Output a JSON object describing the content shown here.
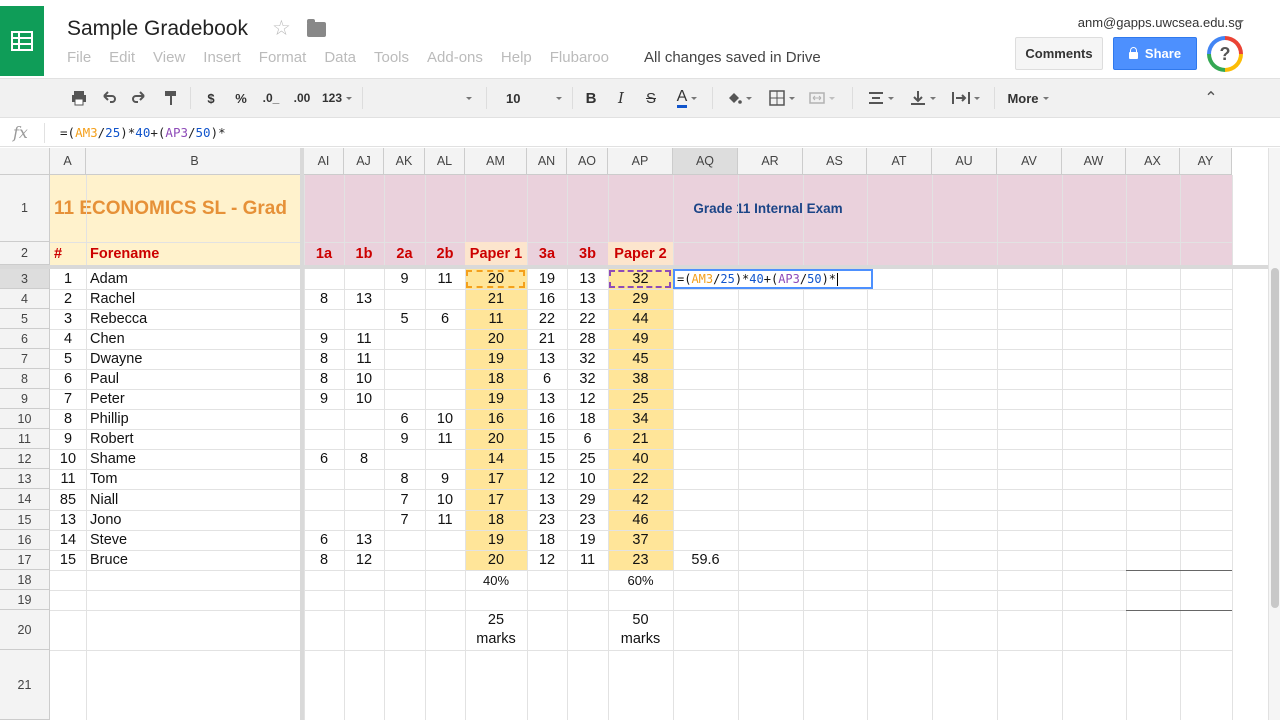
{
  "app": {
    "doc_title": "Sample Gradebook",
    "menus": [
      "File",
      "Edit",
      "View",
      "Insert",
      "Format",
      "Data",
      "Tools",
      "Add-ons",
      "Help",
      "Flubaroo"
    ],
    "save_status": "All changes saved in Drive",
    "account": "anm@gapps.uwcsea.edu.sg",
    "comments_label": "Comments",
    "share_label": "Share",
    "help_glyph": "?",
    "brand_color": "#0f9d58",
    "share_color": "#4d90fe"
  },
  "toolbar": {
    "currency": "$",
    "percent": "%",
    "dec_less": ".0_",
    "dec_more": ".00",
    "format_more": "123",
    "font_size": "10",
    "bold": "B",
    "italic": "I",
    "strike": "S",
    "text_color": "A",
    "more_label": "More"
  },
  "formula_bar": {
    "fx": "fx",
    "parts": [
      "=(",
      "AM3",
      "/",
      "25",
      ")*",
      "40",
      "+(",
      "AP3",
      "/",
      "50",
      ")*"
    ]
  },
  "sheet": {
    "columns": [
      "A",
      "B",
      "AI",
      "AJ",
      "AK",
      "AL",
      "AM",
      "AN",
      "AO",
      "AP",
      "AQ",
      "AR",
      "AS",
      "AT",
      "AU",
      "AV",
      "AW",
      "AX",
      "AY"
    ],
    "row_numbers": [
      "1",
      "2",
      "3",
      "4",
      "5",
      "6",
      "7",
      "8",
      "9",
      "10",
      "11",
      "12",
      "13",
      "14",
      "15",
      "16",
      "17",
      "18",
      "19",
      "20",
      "21"
    ],
    "title_cell": "11 ECONOMICS SL - Grad",
    "exam_banner": "Grade 11 Internal Exam",
    "header_row": [
      "#",
      "Forename",
      "1a",
      "1b",
      "2a",
      "2b",
      "Paper 1",
      "3a",
      "3b",
      "Paper 2"
    ],
    "students": [
      [
        "1",
        "Adam",
        "",
        "",
        "9",
        "11",
        "20",
        "19",
        "13",
        "32"
      ],
      [
        "2",
        "Rachel",
        "8",
        "13",
        "",
        "",
        "21",
        "16",
        "13",
        "29"
      ],
      [
        "3",
        "Rebecca",
        "",
        "",
        "5",
        "6",
        "11",
        "22",
        "22",
        "44"
      ],
      [
        "4",
        "Chen",
        "9",
        "11",
        "",
        "",
        "20",
        "21",
        "28",
        "49"
      ],
      [
        "5",
        "Dwayne",
        "8",
        "11",
        "",
        "",
        "19",
        "13",
        "32",
        "45"
      ],
      [
        "6",
        "Paul",
        "8",
        "10",
        "",
        "",
        "18",
        "6",
        "32",
        "38"
      ],
      [
        "7",
        "Peter",
        "9",
        "10",
        "",
        "",
        "19",
        "13",
        "12",
        "25"
      ],
      [
        "8",
        "Phillip",
        "",
        "",
        "6",
        "10",
        "16",
        "16",
        "18",
        "34"
      ],
      [
        "9",
        "Robert",
        "",
        "",
        "9",
        "11",
        "20",
        "15",
        "6",
        "21"
      ],
      [
        "10",
        "Shame",
        "6",
        "8",
        "",
        "",
        "14",
        "15",
        "25",
        "40"
      ],
      [
        "11",
        "Tom",
        "",
        "",
        "8",
        "9",
        "17",
        "12",
        "10",
        "22"
      ],
      [
        "85",
        "Niall",
        "",
        "",
        "7",
        "10",
        "17",
        "13",
        "29",
        "42"
      ],
      [
        "13",
        "Jono",
        "",
        "",
        "7",
        "11",
        "18",
        "23",
        "23",
        "46"
      ],
      [
        "14",
        "Steve",
        "6",
        "13",
        "",
        "",
        "19",
        "18",
        "19",
        "37"
      ],
      [
        "15",
        "Bruce",
        "8",
        "12",
        "",
        "",
        "20",
        "12",
        "11",
        "23"
      ]
    ],
    "aq17": "59.6",
    "weight_p1": "40%",
    "weight_p2": "60%",
    "marks_p1": [
      "25",
      "marks"
    ],
    "marks_p2": [
      "50",
      "marks"
    ],
    "editing_cell": {
      "parts": [
        "=(",
        "AM3",
        "/",
        "25",
        ")*",
        "40",
        "+(",
        "AP3",
        "/",
        "50",
        ")*"
      ]
    },
    "colors": {
      "title_bg": "#fff2cc",
      "title_text": "#e69138",
      "banner_bg": "#ead1dc",
      "banner_text": "#1c4587",
      "header_text": "#cc0000",
      "paper_bg": "#fce5cd",
      "paper_col_bg": "#ffe599"
    }
  }
}
